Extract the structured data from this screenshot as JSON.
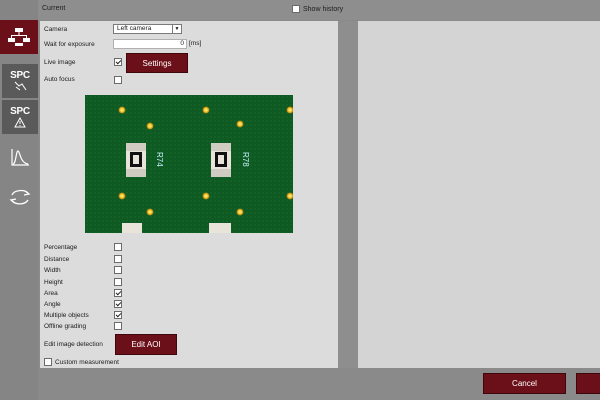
{
  "sidebar": {
    "items": [
      {
        "name": "flowchart",
        "icon": "flowchart-icon",
        "active": true
      },
      {
        "name": "spc-measure",
        "label": "SPC",
        "icon": "spc-chart-icon"
      },
      {
        "name": "spc-warning",
        "label": "SPC",
        "icon": "warning-icon"
      },
      {
        "name": "distribution",
        "icon": "distribution-curve-icon"
      },
      {
        "name": "transfer",
        "icon": "transfer-arrows-icon"
      }
    ]
  },
  "header": {
    "current_label": "Current",
    "show_history_label": "Show history",
    "show_history_checked": false
  },
  "form": {
    "camera_label": "Camera",
    "camera_value": "Left camera",
    "wait_label": "Wait for exposure",
    "wait_value": "0",
    "wait_unit": "[ms]",
    "live_image_label": "Live image",
    "live_image_checked": true,
    "settings_label": "Settings",
    "auto_focus_label": "Auto focus",
    "auto_focus_checked": false
  },
  "image": {
    "component_labels": [
      "R74",
      "R78"
    ]
  },
  "measurements": [
    {
      "label": "Percentage",
      "checked": false
    },
    {
      "label": "Distance",
      "checked": false
    },
    {
      "label": "Width",
      "checked": false
    },
    {
      "label": "Height",
      "checked": false
    },
    {
      "label": "Area",
      "checked": true
    },
    {
      "label": "Angle",
      "checked": true
    },
    {
      "label": "Multiple objects",
      "checked": true
    },
    {
      "label": "Offline grading",
      "checked": false
    }
  ],
  "edit": {
    "detection_label": "Edit image detection",
    "aoi_button": "Edit AOI",
    "custom_label": "Custom measurement",
    "custom_checked": false
  },
  "footer": {
    "cancel_label": "Cancel"
  },
  "colors": {
    "accent": "#6b1018",
    "board_green": "#0e5a22",
    "panel": "#dcdcdc"
  }
}
